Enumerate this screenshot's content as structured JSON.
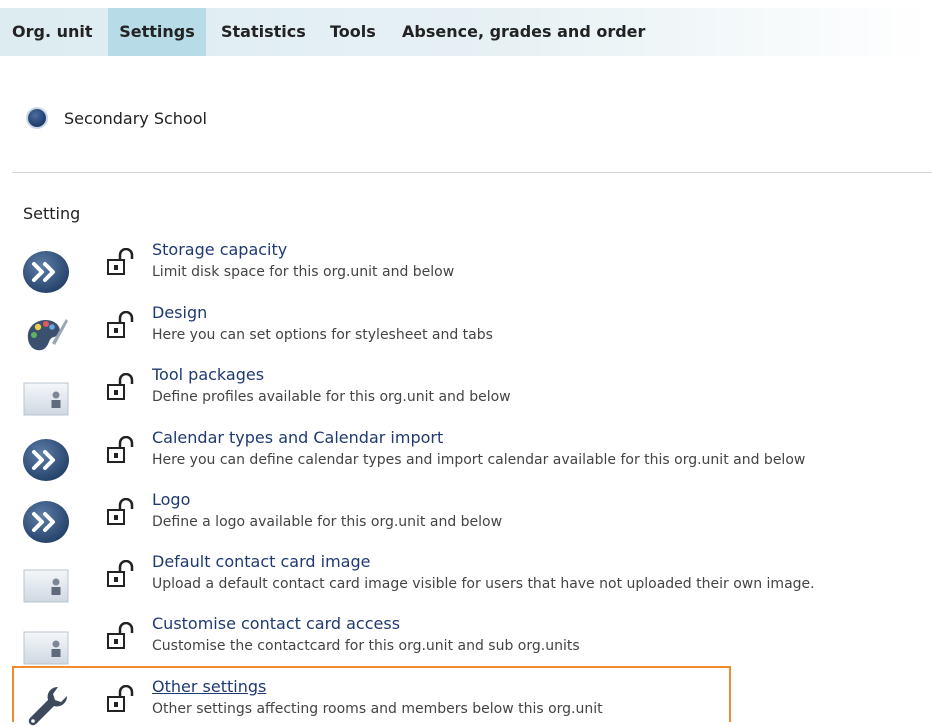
{
  "tabs": [
    {
      "label": "Org. unit",
      "active": false
    },
    {
      "label": "Settings",
      "active": true
    },
    {
      "label": "Statistics",
      "active": false
    },
    {
      "label": "Tools",
      "active": false
    },
    {
      "label": "Absence, grades and order",
      "active": false
    }
  ],
  "org": {
    "selected": "Secondary School"
  },
  "section_title": "Setting",
  "settings": [
    {
      "icon": "arrows-icon",
      "title": "Storage capacity",
      "desc": "Limit disk space for this org.unit and below"
    },
    {
      "icon": "palette-icon",
      "title": "Design",
      "desc": "Here you can set options for stylesheet and tabs"
    },
    {
      "icon": "contact-card-icon",
      "title": "Tool packages",
      "desc": "Define profiles available for this org.unit and below"
    },
    {
      "icon": "arrows-icon",
      "title": "Calendar types and Calendar import",
      "desc": "Here you can define calendar types and import calendar available for this org.unit and below"
    },
    {
      "icon": "arrows-icon",
      "title": "Logo",
      "desc": "Define a logo available for this org.unit and below"
    },
    {
      "icon": "contact-card-icon",
      "title": "Default contact card image",
      "desc": "Upload a default contact card image visible for users that have not uploaded their own image."
    },
    {
      "icon": "contact-card-icon",
      "title": "Customise contact card access",
      "desc": "Customise the contactcard for this org.unit and sub org.units"
    },
    {
      "icon": "wrench-icon",
      "title": "Other settings",
      "desc": "Other settings affecting rooms and members below this org.unit"
    }
  ],
  "colors": {
    "accent": "#ef8a2e",
    "active_tab": "#b8dbe8",
    "link": "#1f3a72"
  }
}
